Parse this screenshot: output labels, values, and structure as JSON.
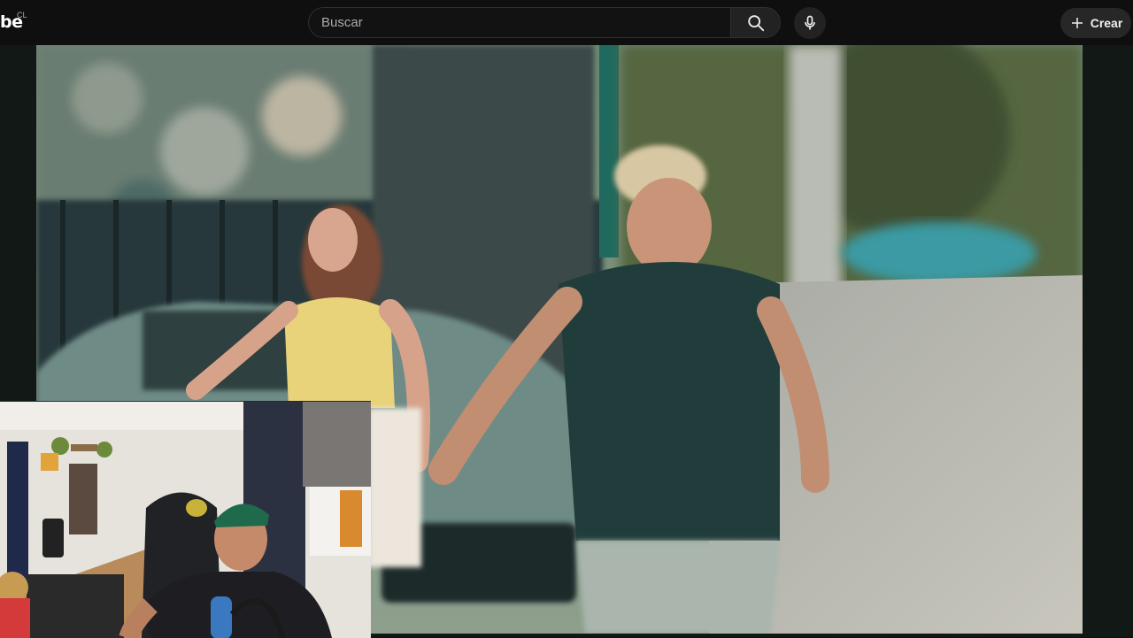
{
  "header": {
    "logo_text": "be",
    "region_code": "CL",
    "search": {
      "placeholder": "Buscar",
      "value": ""
    },
    "icons": {
      "search": "search-icon",
      "mic": "microphone-icon",
      "create": "plus-icon"
    },
    "create_label": "Crear"
  },
  "player": {
    "video_description": "",
    "overlay": "webcam"
  },
  "colors": {
    "header_bg": "#0f0f0f",
    "search_border": "#303030",
    "text_primary": "#f1f1f1",
    "text_secondary": "#aaaaaa",
    "button_bg": "#272727"
  }
}
